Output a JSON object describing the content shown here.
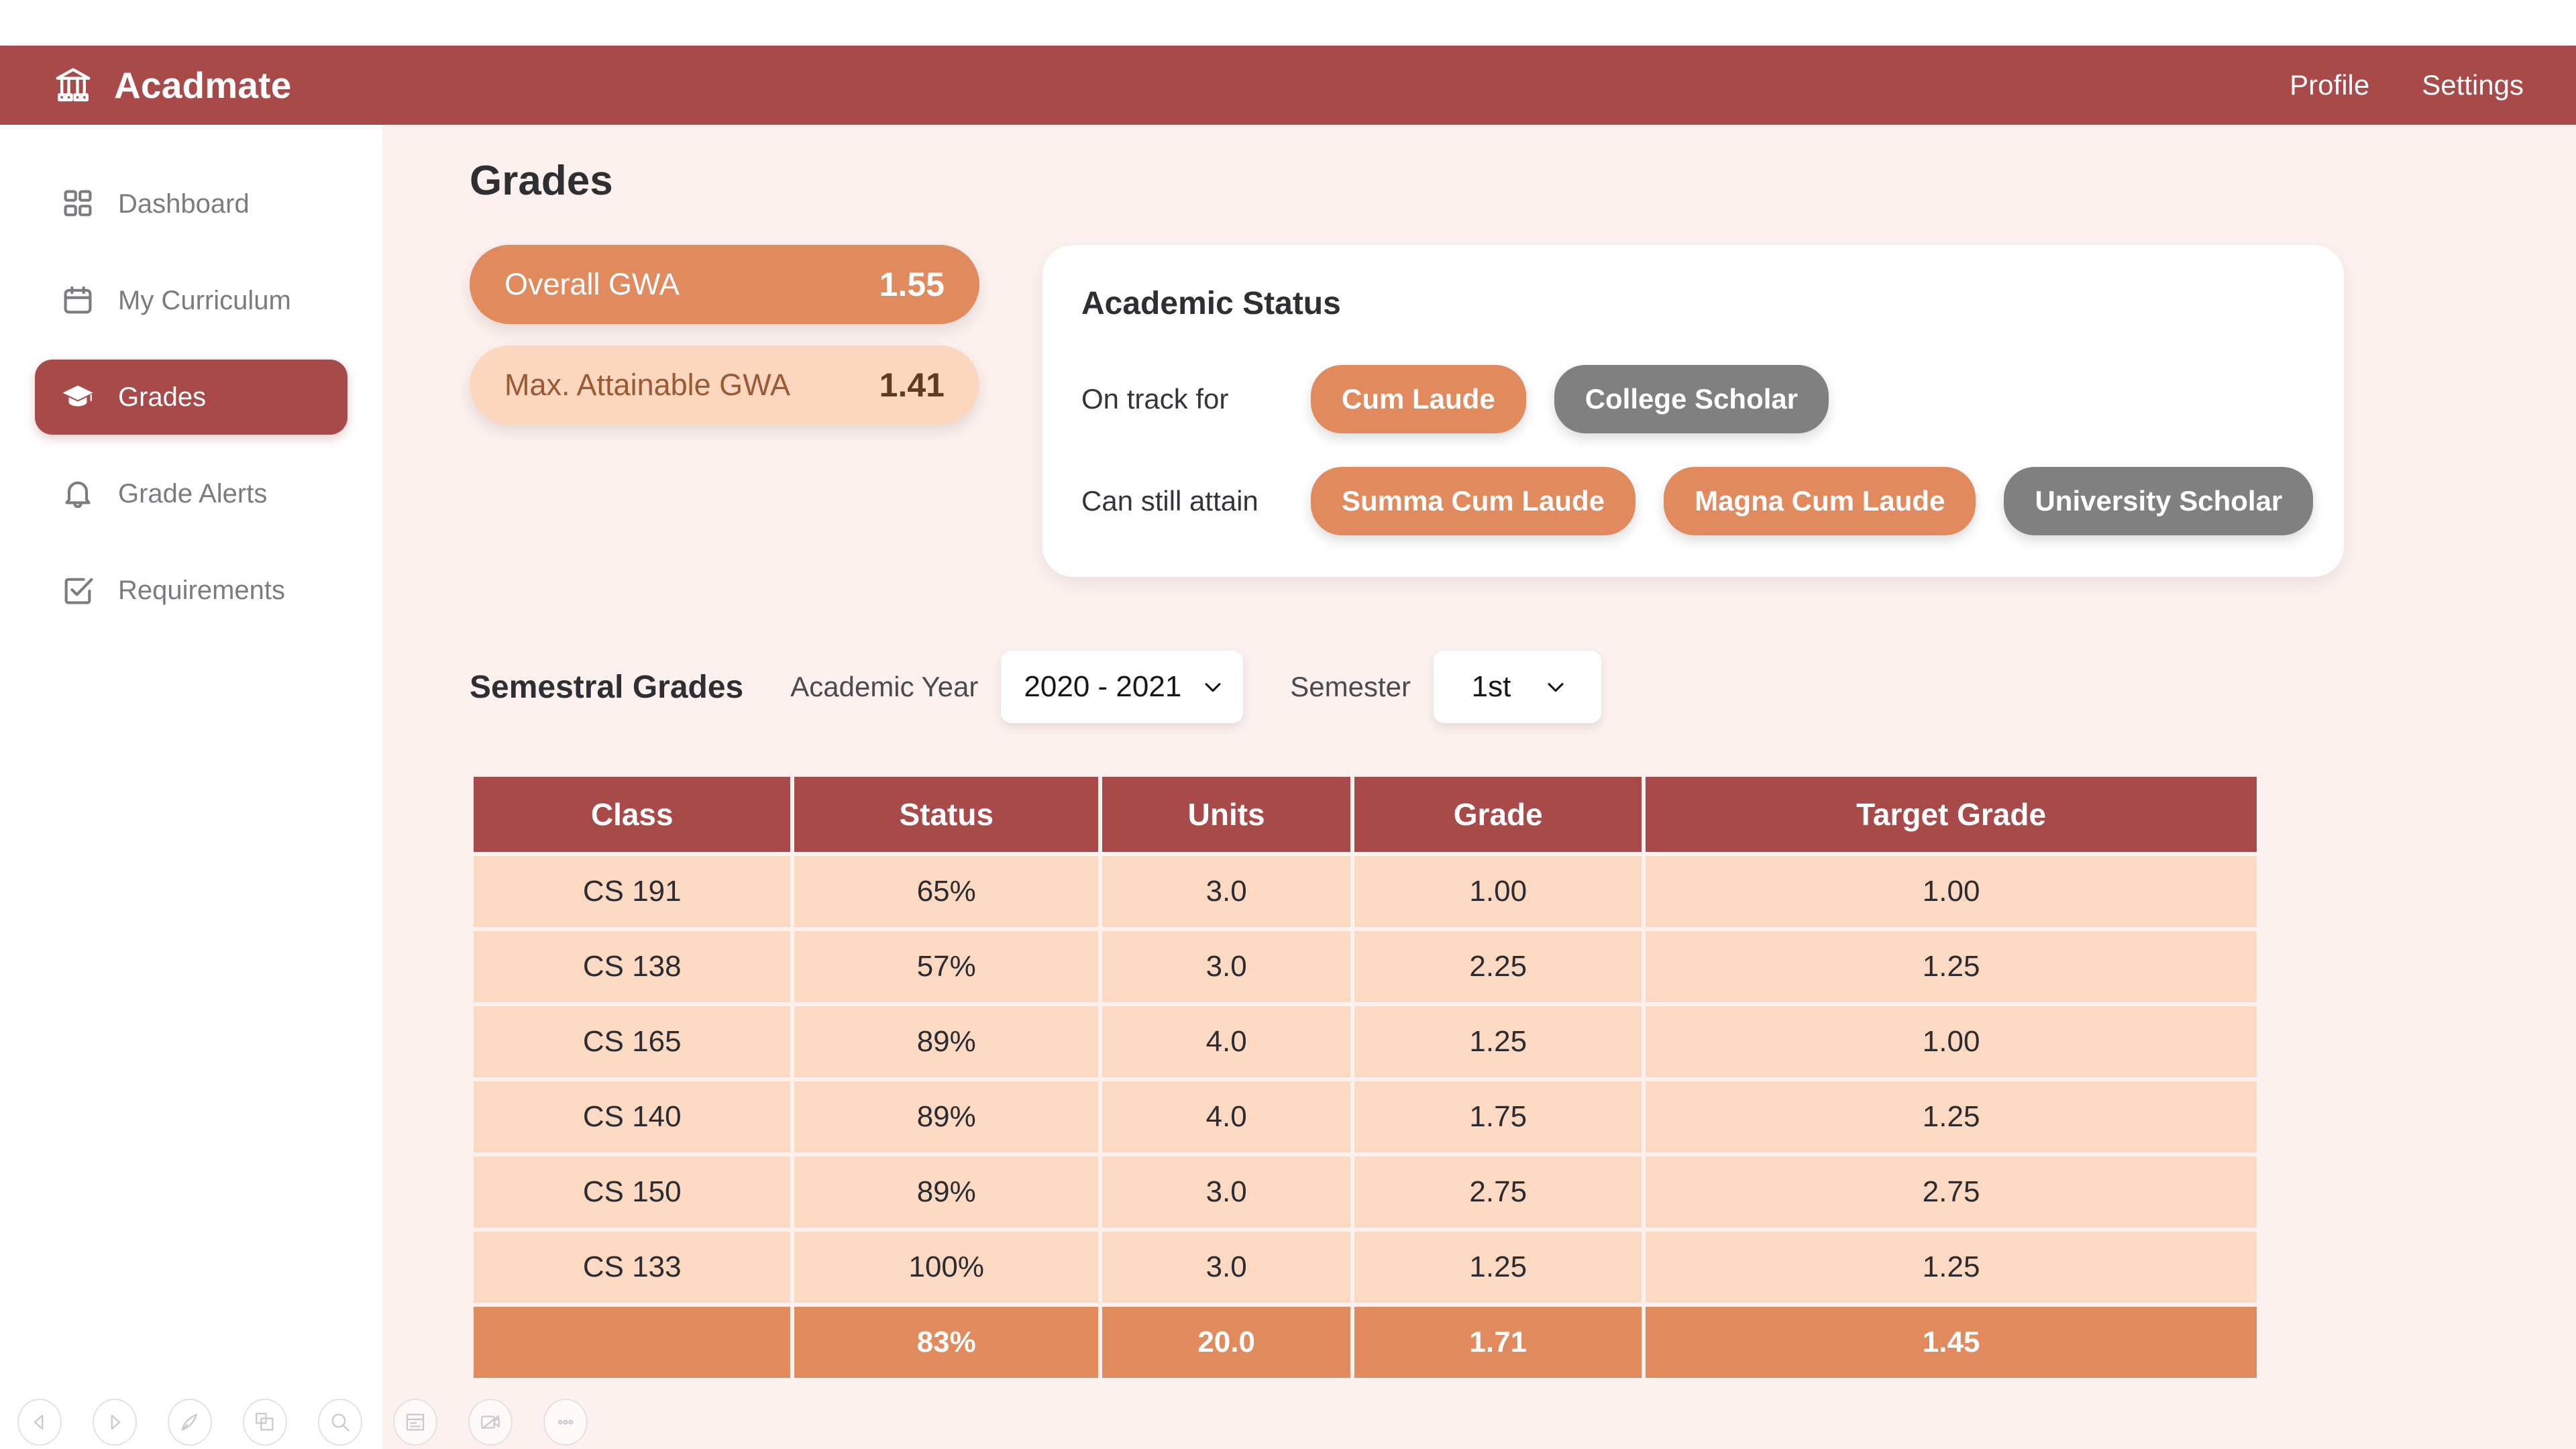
{
  "header": {
    "brand": "Acadmate",
    "logo_icon": "bank-columns-icon",
    "nav": [
      {
        "label": "Profile",
        "name": "profile"
      },
      {
        "label": "Settings",
        "name": "settings"
      }
    ],
    "brand_color": "#a84a4a"
  },
  "sidebar": {
    "items": [
      {
        "label": "Dashboard",
        "icon": "grid-icon",
        "active": false
      },
      {
        "label": "My Curriculum",
        "icon": "calendar-icon",
        "active": false
      },
      {
        "label": "Grades",
        "icon": "graduation-cap-icon",
        "active": true
      },
      {
        "label": "Grade Alerts",
        "icon": "bell-icon",
        "active": false
      },
      {
        "label": "Requirements",
        "icon": "checklist-icon",
        "active": false
      }
    ]
  },
  "main": {
    "page_title": "Grades",
    "gwa_cards": [
      {
        "label": "Overall GWA",
        "value": "1.55",
        "style": "primary"
      },
      {
        "label": "Max. Attainable GWA",
        "value": "1.41",
        "style": "secondary"
      }
    ],
    "academic_status": {
      "title": "Academic Status",
      "rows": [
        {
          "label": "On track for",
          "chips": [
            {
              "label": "Cum Laude",
              "color": "orange"
            },
            {
              "label": "College Scholar",
              "color": "gray"
            }
          ]
        },
        {
          "label": "Can still attain",
          "chips": [
            {
              "label": "Summa Cum Laude",
              "color": "orange"
            },
            {
              "label": "Magna Cum Laude",
              "color": "orange"
            },
            {
              "label": "University Scholar",
              "color": "gray"
            }
          ]
        }
      ]
    },
    "semestral": {
      "title": "Semestral Grades",
      "academic_year_label": "Academic Year",
      "academic_year_value": "2020 - 2021",
      "semester_label": "Semester",
      "semester_value": "1st"
    },
    "table": {
      "columns": [
        "Class",
        "Status",
        "Units",
        "Grade",
        "Target Grade"
      ],
      "rows": [
        [
          "CS 191",
          "65%",
          "3.0",
          "1.00",
          "1.00"
        ],
        [
          "CS 138",
          "57%",
          "3.0",
          "2.25",
          "1.25"
        ],
        [
          "CS 165",
          "89%",
          "4.0",
          "1.25",
          "1.00"
        ],
        [
          "CS 140",
          "89%",
          "4.0",
          "1.75",
          "1.25"
        ],
        [
          "CS 150",
          "89%",
          "3.0",
          "2.75",
          "2.75"
        ],
        [
          "CS 133",
          "100%",
          "3.0",
          "1.25",
          "1.25"
        ]
      ],
      "total_row": [
        "",
        "83%",
        "20.0",
        "1.71",
        "1.45"
      ]
    }
  },
  "bottom_toolbar": {
    "buttons": [
      {
        "name": "back-icon"
      },
      {
        "name": "forward-icon"
      },
      {
        "name": "pen-icon"
      },
      {
        "name": "copy-icon"
      },
      {
        "name": "search-icon"
      },
      {
        "name": "card-icon"
      },
      {
        "name": "video-off-icon"
      },
      {
        "name": "more-icon"
      }
    ]
  },
  "colors": {
    "brand_maroon": "#a84a4a",
    "accent_orange": "#e08a5d",
    "soft_orange": "#fbd7bf",
    "row_peach": "#fcd9c2",
    "page_bg": "#fdf1ef",
    "chip_gray": "#808080"
  }
}
